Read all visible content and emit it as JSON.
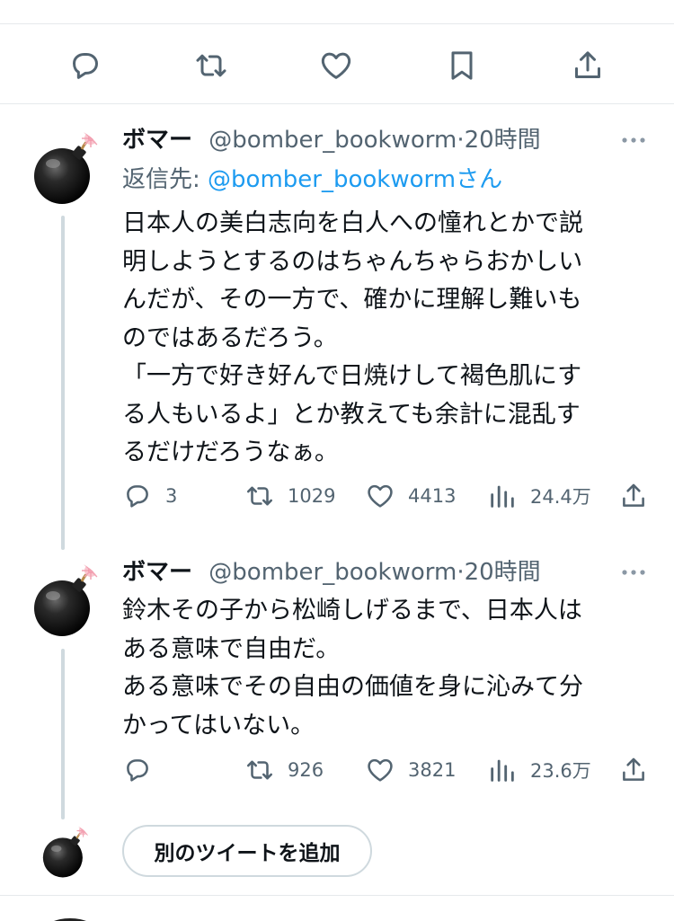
{
  "colors": {
    "text": "#0f1419",
    "secondary": "#536471",
    "link": "#1d9bf0",
    "divider": "#e6e9ec",
    "thread_line": "#cfd9de"
  },
  "action_bar": {
    "icons": [
      "reply-icon",
      "retweet-icon",
      "like-icon",
      "bookmark-icon",
      "share-icon"
    ]
  },
  "tweets": [
    {
      "display_name": "ボマー",
      "handle": "@bomber_bookworm",
      "separator": "·",
      "time": "20時間",
      "reply_prefix": "返信先: ",
      "reply_mention": "@bomber_bookworm",
      "reply_suffix": "さん",
      "lines": [
        "日本人の美白志向を白人への憧れとかで説",
        "明しようとするのはちゃんちゃらおかしい",
        "んだが、その一方で、確かに理解し難いも",
        "のではあるだろう。",
        "「一方で好き好んで日焼けして褐色肌にす",
        "る人もいるよ」とか教えても余計に混乱す",
        "るだけだろうなぁ。"
      ],
      "replies": "3",
      "retweets": "1029",
      "likes": "4413",
      "views": "24.4万"
    },
    {
      "display_name": "ボマー",
      "handle": "@bomber_bookworm",
      "separator": "·",
      "time": "20時間",
      "lines": [
        "鈴木その子から松崎しげるまで、日本人は",
        "ある意味で自由だ。",
        "ある意味でその自由の価値を身に沁みて分",
        "かってはいない。"
      ],
      "replies": "",
      "retweets": "926",
      "likes": "3821",
      "views": "23.6万"
    }
  ],
  "compose": {
    "add_tweet_label": "別のツイートを追加"
  }
}
